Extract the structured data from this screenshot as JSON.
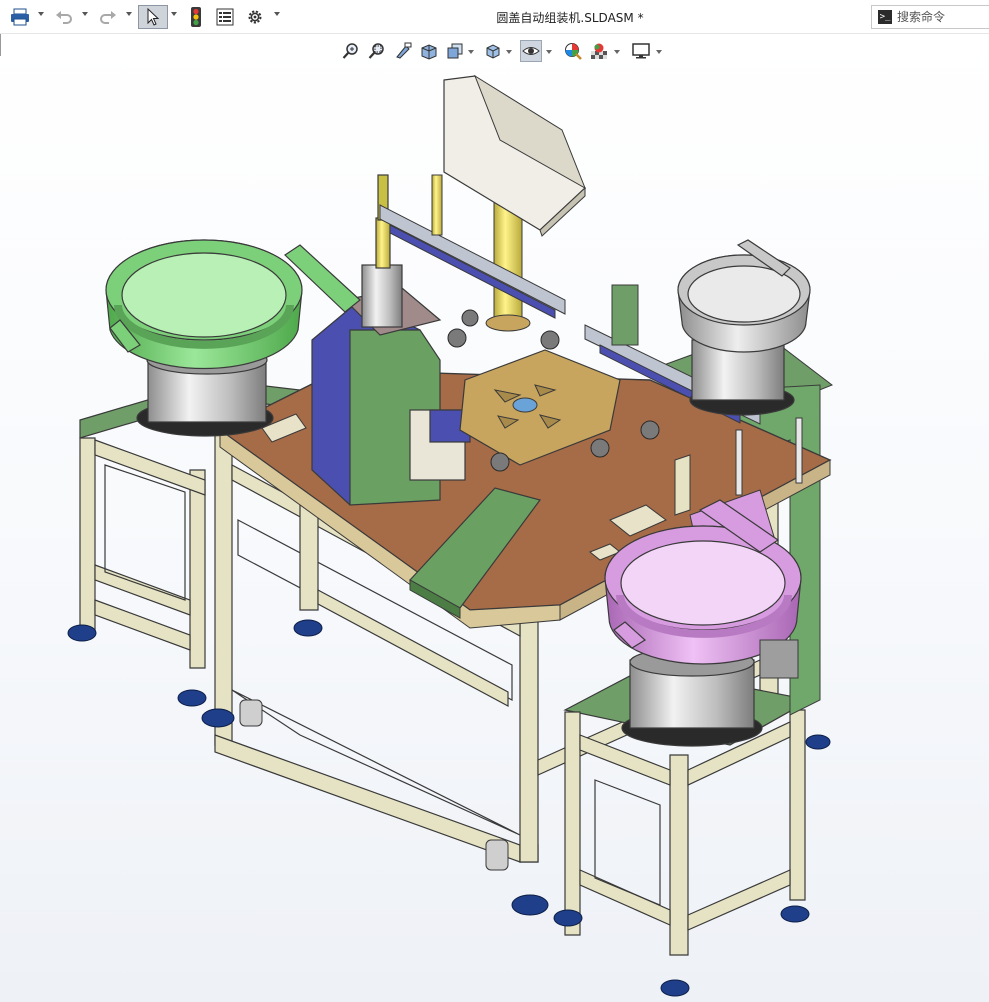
{
  "window": {
    "title": "圆盖自动组装机.SLDASM *"
  },
  "quick_access": {
    "print": "printer-icon",
    "undo": "undo-icon",
    "redo": "redo-icon",
    "select": "select-arrow-icon",
    "rebuild": "traffic-light-icon",
    "file_properties": "file-properties-icon",
    "options": "gear-icon"
  },
  "command_search": {
    "placeholder": "搜索命令"
  },
  "view_toolbar": {
    "items": [
      "zoom-to-fit-icon",
      "zoom-to-area-icon",
      "previous-view-icon",
      "section-view-icon",
      "view-orientation-icon",
      "display-style-icon",
      "hide-show-items-icon",
      "edit-appearance-icon",
      "apply-scene-icon",
      "view-settings-icon"
    ]
  },
  "colors": {
    "frame": "#e6e3c4",
    "frame_edge": "#3a3a3a",
    "tabletop": "#a66b47",
    "green_plate": "#6f9e68",
    "bowl_green": "#7dd07a",
    "bowl_grey": "#c8c8c8",
    "bowl_pink": "#d79be0",
    "feet": "#1f3f8a",
    "housing_blue": "#4a4fb0",
    "turntable": "#c8a55e",
    "panel": "#f0eee6"
  }
}
